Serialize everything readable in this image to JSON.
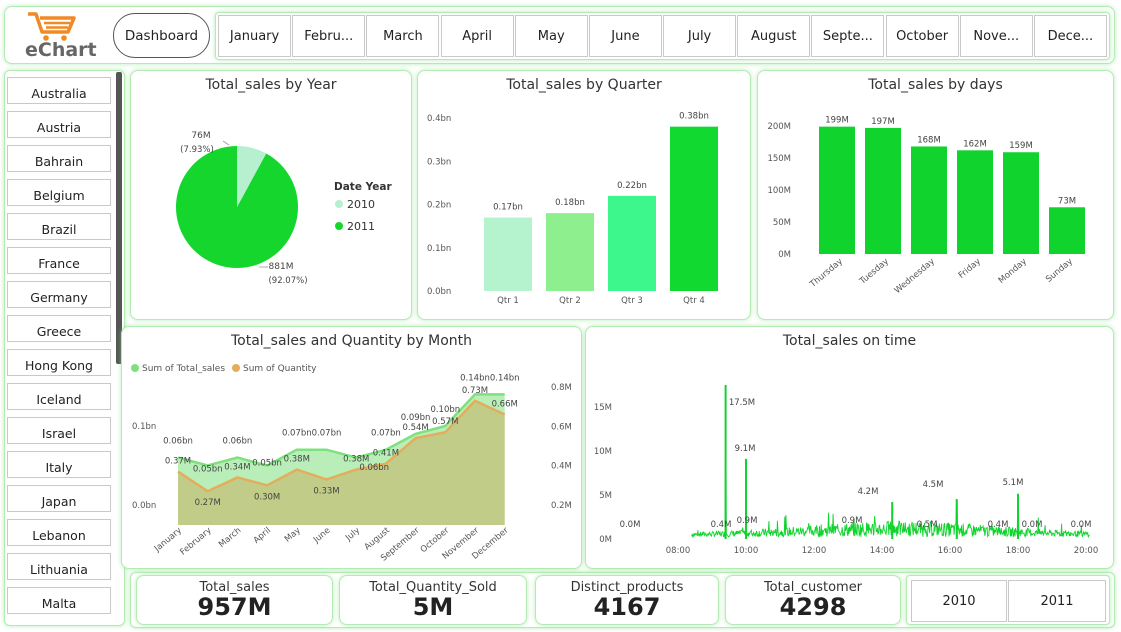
{
  "colors": {
    "accent_green": "#10d32e",
    "panel_border": "#b3ecb3",
    "quarter_colors": [
      "#b5f3ce",
      "#8eef8e",
      "#3df78c",
      "#12d92f"
    ],
    "pie_2010": "#b6f0cf",
    "pie_2011": "#14d62c",
    "area_sales": "#7fe07f",
    "area_quantity": "#e3ad5c",
    "logo_orange": "#f08a24"
  },
  "logo": {
    "text": "eChart",
    "icon": "shopping-cart-icon"
  },
  "header": {
    "dashboard_label": "Dashboard",
    "months": [
      "January",
      "Febru...",
      "March",
      "April",
      "May",
      "June",
      "July",
      "August",
      "Septe...",
      "October",
      "Nove...",
      "Dece..."
    ]
  },
  "sidebar": {
    "countries": [
      "Australia",
      "Austria",
      "Bahrain",
      "Belgium",
      "Brazil",
      "France",
      "Germany",
      "Greece",
      "Hong Kong",
      "Iceland",
      "Israel",
      "Italy",
      "Japan",
      "Lebanon",
      "Lithuania",
      "Malta"
    ]
  },
  "panels": {
    "year": {
      "title": "Total_sales by Year"
    },
    "quarter": {
      "title": "Total_sales by Quarter"
    },
    "days": {
      "title": "Total_sales by days"
    },
    "month": {
      "title": "Total_sales and Quantity by Month"
    },
    "time": {
      "title": "Total_sales on time"
    }
  },
  "kpis": [
    {
      "label": "Total_sales",
      "value": "957M"
    },
    {
      "label": "Total_Quantity_Sold",
      "value": "5M"
    },
    {
      "label": "Distinct_products",
      "value": "4167"
    },
    {
      "label": "Total_customer",
      "value": "4298"
    }
  ],
  "year_buttons": [
    "2010",
    "2011"
  ],
  "chart_data": [
    {
      "type": "pie",
      "title": "Total_sales by Year",
      "legend_title": "Date Year",
      "legend_position": "right",
      "slices": [
        {
          "name": "2010",
          "value": 76,
          "label": "76M",
          "pct_label": "(7.93%)"
        },
        {
          "name": "2011",
          "value": 881,
          "label": "881M",
          "pct_label": "(92.07%)"
        }
      ]
    },
    {
      "type": "bar",
      "title": "Total_sales by Quarter",
      "categories": [
        "Qtr 1",
        "Qtr 2",
        "Qtr 3",
        "Qtr 4"
      ],
      "values": [
        0.17,
        0.18,
        0.22,
        0.38
      ],
      "data_labels": [
        "0.17bn",
        "0.18bn",
        "0.22bn",
        "0.38bn"
      ],
      "y_ticks": [
        "0.0bn",
        "0.1bn",
        "0.2bn",
        "0.3bn",
        "0.4bn"
      ],
      "ylim": [
        0,
        0.4
      ]
    },
    {
      "type": "bar",
      "title": "Total_sales by days",
      "categories": [
        "Thursday",
        "Tuesday",
        "Wednesday",
        "Friday",
        "Monday",
        "Sunday"
      ],
      "values": [
        199,
        197,
        168,
        162,
        159,
        73
      ],
      "data_labels": [
        "199M",
        "197M",
        "168M",
        "162M",
        "159M",
        "73M"
      ],
      "y_ticks": [
        "0M",
        "50M",
        "100M",
        "150M",
        "200M"
      ],
      "ylim": [
        0,
        200
      ]
    },
    {
      "type": "area",
      "title": "Total_sales and Quantity by Month",
      "legend_position": "top-left",
      "categories": [
        "January",
        "February",
        "March",
        "April",
        "May",
        "June",
        "July",
        "August",
        "September",
        "October",
        "November",
        "December"
      ],
      "series": [
        {
          "name": "Sum of Total_sales",
          "axis": "left",
          "values": [
            0.06,
            0.05,
            0.06,
            0.05,
            0.07,
            0.07,
            0.06,
            0.07,
            0.09,
            0.1,
            0.14,
            0.14
          ],
          "labels": [
            "0.06bn",
            "0.05bn",
            "0.06bn",
            "0.05bn",
            "0.07bn",
            "0.07bn",
            "",
            "0.07bn",
            "0.09bn",
            "0.10bn",
            "0.14bn",
            "0.14bn"
          ]
        },
        {
          "name": "Sum of Quantity",
          "axis": "right",
          "values": [
            0.37,
            0.27,
            0.34,
            0.3,
            0.38,
            0.33,
            0.38,
            0.41,
            0.54,
            0.57,
            0.73,
            0.66
          ],
          "labels": [
            "0.37M",
            "0.27M",
            "0.34M",
            "0.30M",
            "0.38M",
            "0.33M",
            "0.38M",
            "0.41M",
            "0.54M",
            "0.57M",
            "0.73M",
            "0.66M"
          ]
        }
      ],
      "extra_label": "0.06bn",
      "y_left_ticks": [
        "0.0bn",
        "0.1bn"
      ],
      "y_right_ticks": [
        "0.2M",
        "0.4M",
        "0.6M",
        "0.8M"
      ],
      "y_left_lim": [
        0,
        0.16
      ],
      "y_right_lim": [
        0.2,
        0.8
      ]
    },
    {
      "type": "line",
      "title": "Total_sales on time",
      "x_ticks": [
        "08:00",
        "10:00",
        "12:00",
        "14:00",
        "16:00",
        "18:00",
        "20:00"
      ],
      "y_ticks": [
        "0M",
        "5M",
        "10M",
        "15M"
      ],
      "ylim": [
        0,
        18
      ],
      "peaks": [
        {
          "time": 7.5,
          "value": 0.0,
          "label": "0.0M"
        },
        {
          "time": 9.25,
          "value": 0.4,
          "label": "0.4M"
        },
        {
          "time": 9.4,
          "value": 17.5,
          "label": "17.5M"
        },
        {
          "time": 10.0,
          "value": 0.9,
          "label": "0.9M"
        },
        {
          "time": 10.0,
          "value": 9.1,
          "label": "9.1M"
        },
        {
          "time": 13.1,
          "value": 0.9,
          "label": "0.9M"
        },
        {
          "time": 14.3,
          "value": 4.2,
          "label": "4.2M"
        },
        {
          "time": 16.2,
          "value": 4.5,
          "label": "4.5M"
        },
        {
          "time": 16.0,
          "value": 0.5,
          "label": "0.5M"
        },
        {
          "time": 17.8,
          "value": 0.4,
          "label": "0.4M"
        },
        {
          "time": 18.0,
          "value": 0.0,
          "label": "0.0M"
        },
        {
          "time": 18.0,
          "value": 5.1,
          "label": "5.1M"
        },
        {
          "time": 20.0,
          "value": 0.0,
          "label": "0.0M"
        }
      ]
    }
  ]
}
